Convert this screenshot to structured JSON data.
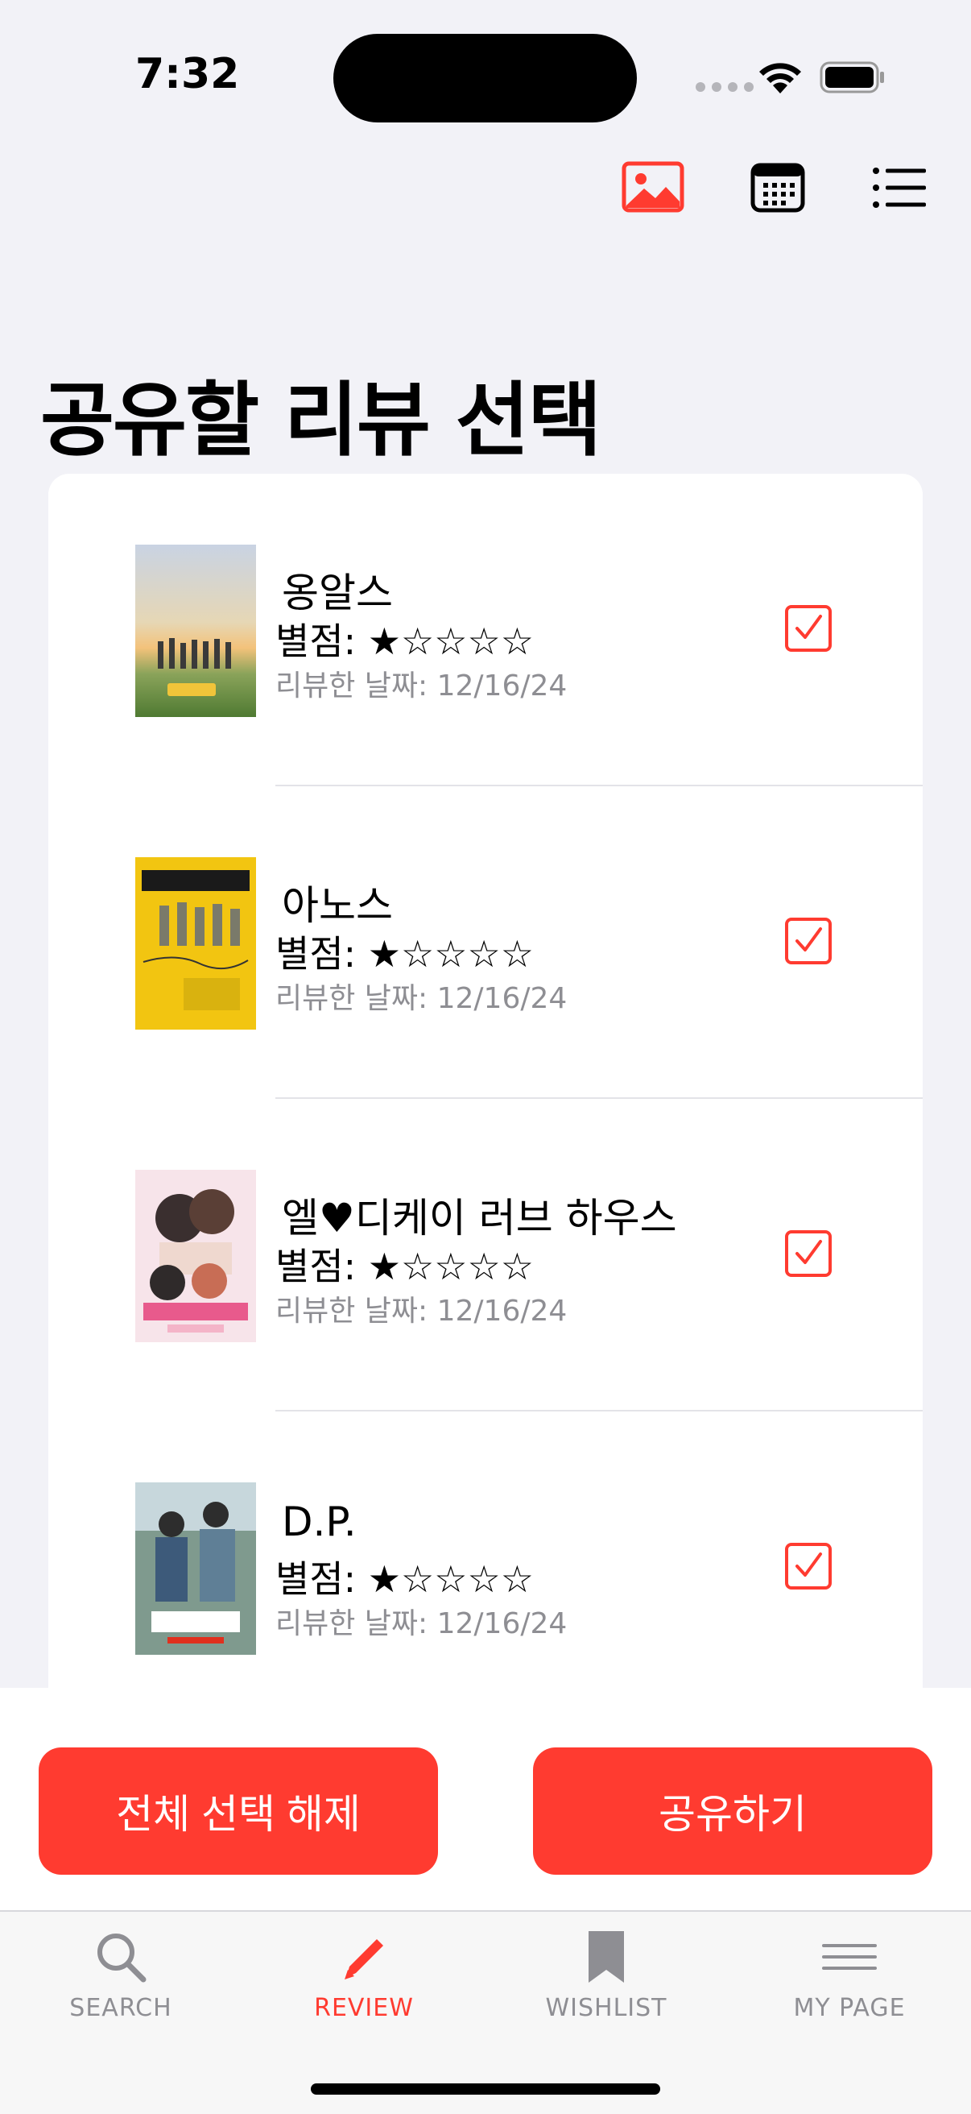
{
  "status_bar": {
    "time": "7:32"
  },
  "toolbar": {
    "image_icon": "image-icon",
    "calendar_icon": "calendar-icon",
    "list_icon": "list-icon",
    "accent": "#ff3b30"
  },
  "page_title": "공유할 리뷰 선택",
  "reviews": [
    {
      "title": "옹알스",
      "rating_label": "별점: ★☆☆☆☆",
      "date_label": "리뷰한 날짜: 12/16/24",
      "selected": true
    },
    {
      "title": "아노스",
      "rating_label": "별점: ★☆☆☆☆",
      "date_label": "리뷰한 날짜: 12/16/24",
      "selected": true
    },
    {
      "title": "엘♥디케이 러브 하우스",
      "rating_label": "별점: ★☆☆☆☆",
      "date_label": "리뷰한 날짜: 12/16/24",
      "selected": true
    },
    {
      "title": "D.P.",
      "rating_label": "별점: ★☆☆☆☆",
      "date_label": "리뷰한 날짜: 12/16/24",
      "selected": true
    }
  ],
  "actions": {
    "deselect_all": "전체 선택 해제",
    "share": "공유하기"
  },
  "tabbar": {
    "items": [
      {
        "label": "SEARCH",
        "icon": "search-icon"
      },
      {
        "label": "REVIEW",
        "icon": "pencil-icon",
        "active": true
      },
      {
        "label": "WISHLIST",
        "icon": "bookmark-icon"
      },
      {
        "label": "MY PAGE",
        "icon": "menu-icon"
      }
    ],
    "active_color": "#ff3b30",
    "inactive_color": "#8e8e93"
  }
}
